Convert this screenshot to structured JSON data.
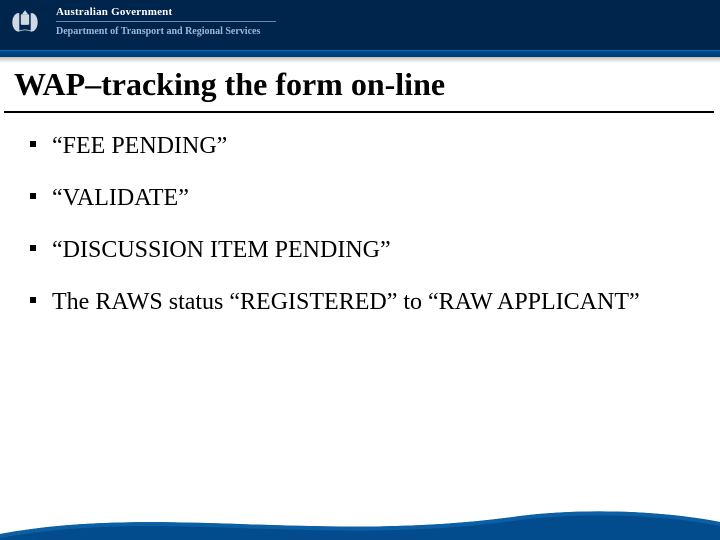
{
  "header": {
    "gov_name": "Australian Government",
    "dept_name": "Department of Transport and Regional Services"
  },
  "title": "WAP–tracking the form on-line",
  "bullets": [
    "“FEE PENDING”",
    "“VALIDATE”",
    "“DISCUSSION ITEM PENDING”",
    "The RAWS status “REGISTERED” to “RAW APPLICANT”"
  ]
}
